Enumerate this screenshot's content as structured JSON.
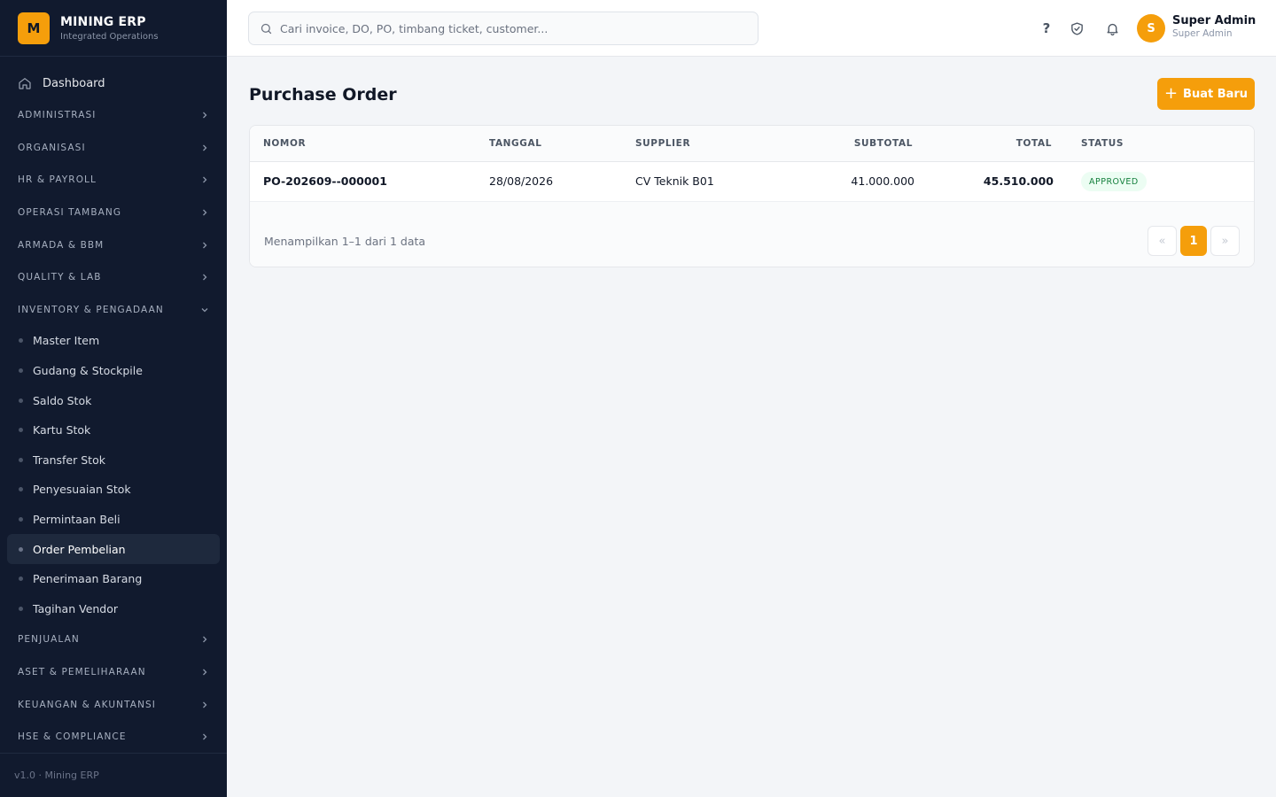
{
  "brand": {
    "logo_letter": "M",
    "name": "MINING ERP",
    "subtitle": "Integrated Operations"
  },
  "sidebar": {
    "dashboard": "Dashboard",
    "sections_top": [
      "ADMINISTRASI",
      "ORGANISASI",
      "HR & PAYROLL",
      "OPERASI TAMBANG",
      "ARMADA & BBM",
      "QUALITY & LAB"
    ],
    "expanded_section": "INVENTORY & PENGADAAN",
    "sub_items": [
      "Master Item",
      "Gudang & Stockpile",
      "Saldo Stok",
      "Kartu Stok",
      "Transfer Stok",
      "Penyesuaian Stok",
      "Permintaan Beli",
      "Order Pembelian",
      "Penerimaan Barang",
      "Tagihan Vendor"
    ],
    "active_item": "Order Pembelian",
    "sections_bottom": [
      "PENJUALAN",
      "ASET & PEMELIHARAAN",
      "KEUANGAN & AKUNTANSI",
      "HSE & COMPLIANCE"
    ],
    "footer": "v1.0 · Mining ERP"
  },
  "header": {
    "search_placeholder": "Cari invoice, DO, PO, timbang ticket, customer...",
    "help_icon": "question-icon",
    "shield_icon": "shield-check-icon",
    "bell_icon": "bell-icon",
    "avatar_letter": "S",
    "user_name": "Super Admin",
    "user_role": "Super Admin"
  },
  "page": {
    "title": "Purchase Order",
    "new_button": "Buat Baru"
  },
  "table": {
    "columns": [
      "NOMOR",
      "TANGGAL",
      "SUPPLIER",
      "SUBTOTAL",
      "TOTAL",
      "STATUS"
    ],
    "rows": [
      {
        "nomor": "PO-202609--000001",
        "tanggal": "28/08/2026",
        "supplier": "CV Teknik B01",
        "subtotal": "41.000.000",
        "total": "45.510.000",
        "status": "APPROVED"
      }
    ],
    "summary": "Menampilkan 1–1 dari 1 data",
    "pagination": {
      "prev": "«",
      "current": "1",
      "next": "»"
    }
  },
  "colors": {
    "accent": "#f59e0b",
    "sidebar_bg": "#111a2e",
    "status_approved": "#15803d"
  }
}
